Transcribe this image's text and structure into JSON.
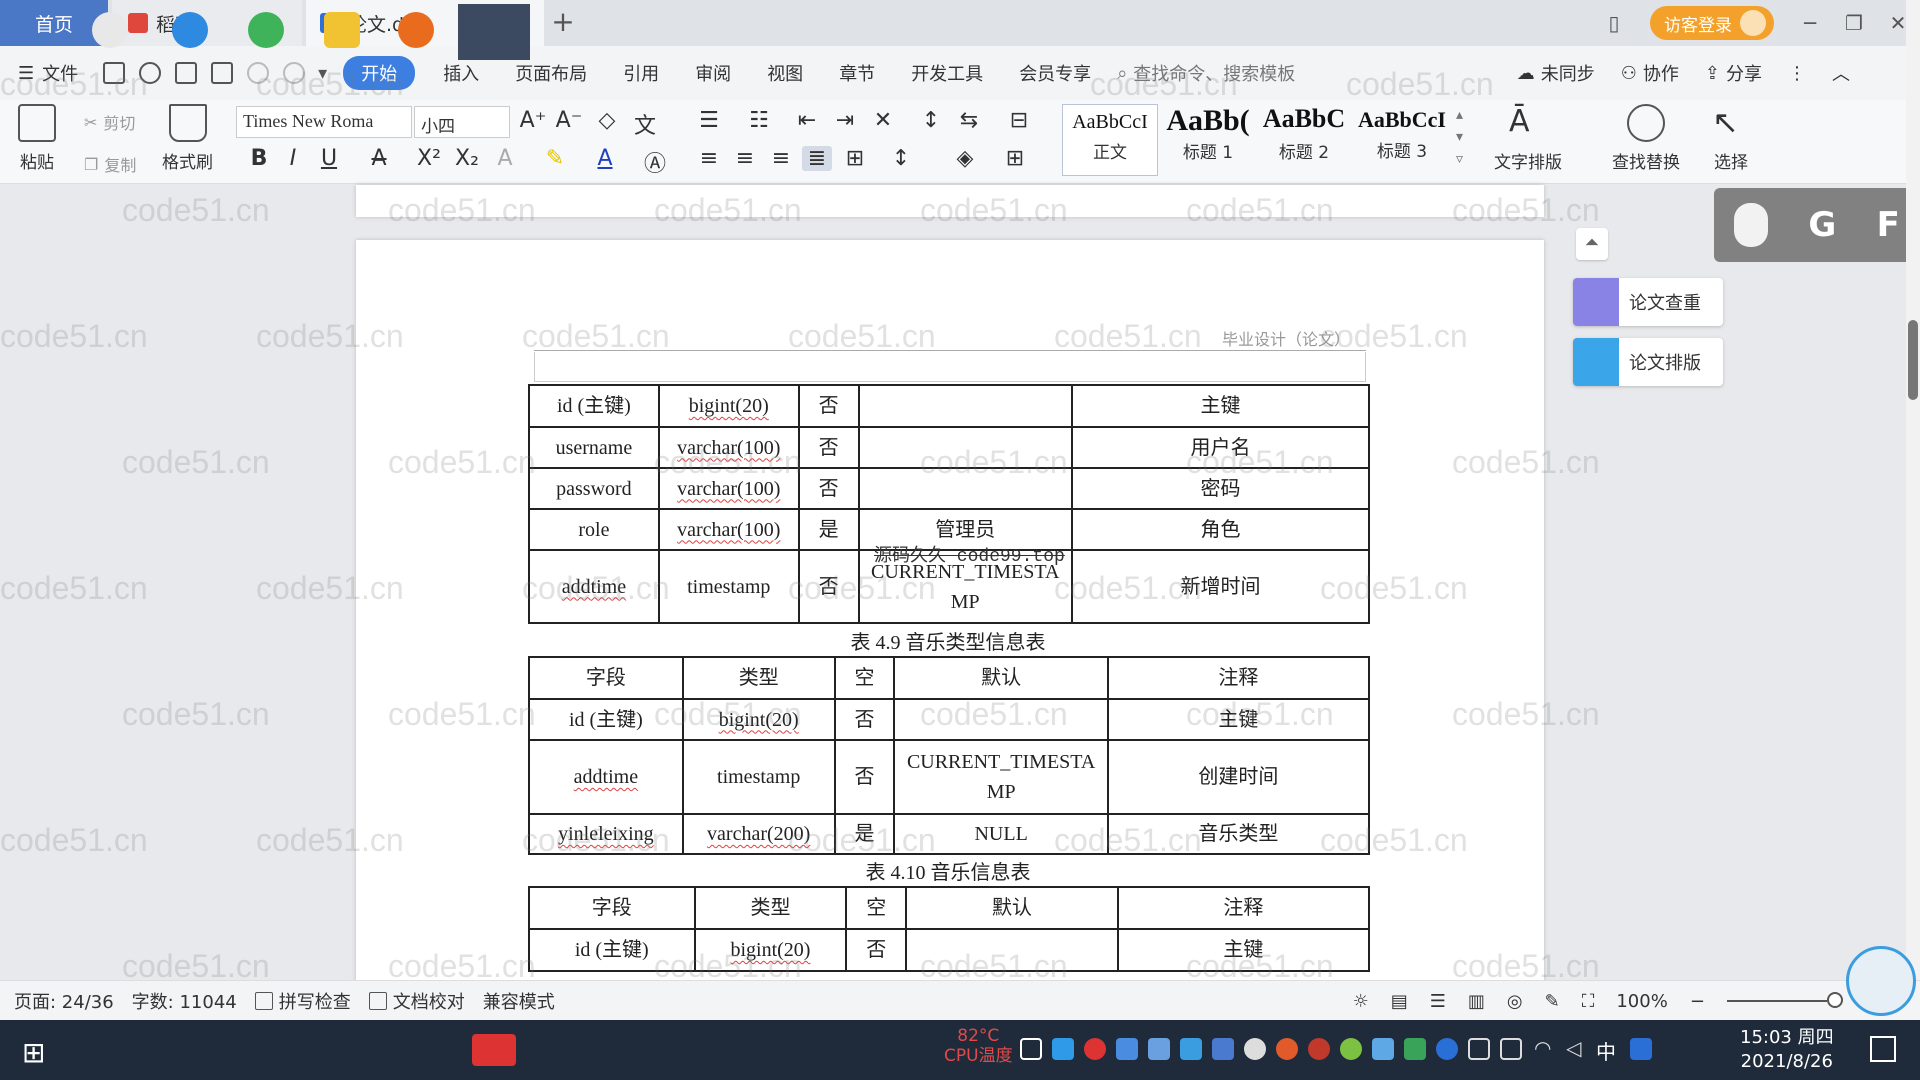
{
  "tabs": {
    "home": "首页",
    "daoke": "稻壳",
    "doc": "论文.doc"
  },
  "titlebar": {
    "login": "访客登录"
  },
  "menu": {
    "file": "文件",
    "start": "开始",
    "items": [
      "插入",
      "页面布局",
      "引用",
      "审阅",
      "视图",
      "章节",
      "开发工具",
      "会员专享"
    ],
    "search_placeholder": "查找命令、搜索模板",
    "sync": "未同步",
    "collab": "协作",
    "share": "分享"
  },
  "ribbon": {
    "paste": "粘贴",
    "cut": "剪切",
    "copy": "复制",
    "format_painter": "格式刷",
    "font_name": "Times New Roma",
    "font_size": "小四",
    "styles": [
      {
        "preview": "AaBbCcI",
        "name": "正文"
      },
      {
        "preview": "AaBb(",
        "name": "标题 1"
      },
      {
        "preview": "AaBbC",
        "name": "标题 2"
      },
      {
        "preview": "AaBbCcI",
        "name": "标题 3"
      }
    ],
    "text_layout": "文字排版",
    "find_replace": "查找替换",
    "select": "选择"
  },
  "document": {
    "header": "毕业设计（论文）",
    "overlay_text": "源码久久 code99.top",
    "table1_rows": [
      [
        "id (主键)",
        "bigint(20)",
        "否",
        "",
        "主键"
      ],
      [
        "username",
        "varchar(100)",
        "否",
        "",
        "用户名"
      ],
      [
        "password",
        "varchar(100)",
        "否",
        "",
        "密码"
      ],
      [
        "role",
        "varchar(100)",
        "是",
        "管理员",
        "角色"
      ],
      [
        "addtime",
        "timestamp",
        "否",
        "CURRENT_TIMESTAMP",
        "新增时间"
      ]
    ],
    "caption2": "表 4.9  音乐类型信息表",
    "table2_header": [
      "字段",
      "类型",
      "空",
      "默认",
      "注释"
    ],
    "table2_rows": [
      [
        "id (主键)",
        "bigint(20)",
        "否",
        "",
        "主键"
      ],
      [
        "addtime",
        "timestamp",
        "否",
        "CURRENT_TIMESTAMP",
        "创建时间"
      ],
      [
        "yinleleixing",
        "varchar(200)",
        "是",
        "NULL",
        "音乐类型"
      ]
    ],
    "caption3": "表 4.10  音乐信息表",
    "table3_header": [
      "字段",
      "类型",
      "空",
      "默认",
      "注释"
    ],
    "table3_rows": [
      [
        "id (主键)",
        "bigint(20)",
        "否",
        "",
        "主键"
      ]
    ]
  },
  "side_tools": {
    "check": "论文查重",
    "layout": "论文排版"
  },
  "floatbar_letters": [
    "G",
    "F"
  ],
  "watermark": "code51.cn",
  "status": {
    "page": "页面: 24/36",
    "words": "字数: 11044",
    "spell": "拼写检查",
    "proof": "文档校对",
    "compat": "兼容模式",
    "zoom": "100%"
  },
  "taskbar": {
    "cpu_temp": "82°C",
    "cpu_label": "CPU温度",
    "time": "15:03 周四",
    "date": "2021/8/26"
  },
  "colors": {
    "accent": "#3c7fe0",
    "home_tab": "#4a78c6",
    "login": "#f3a12a"
  }
}
